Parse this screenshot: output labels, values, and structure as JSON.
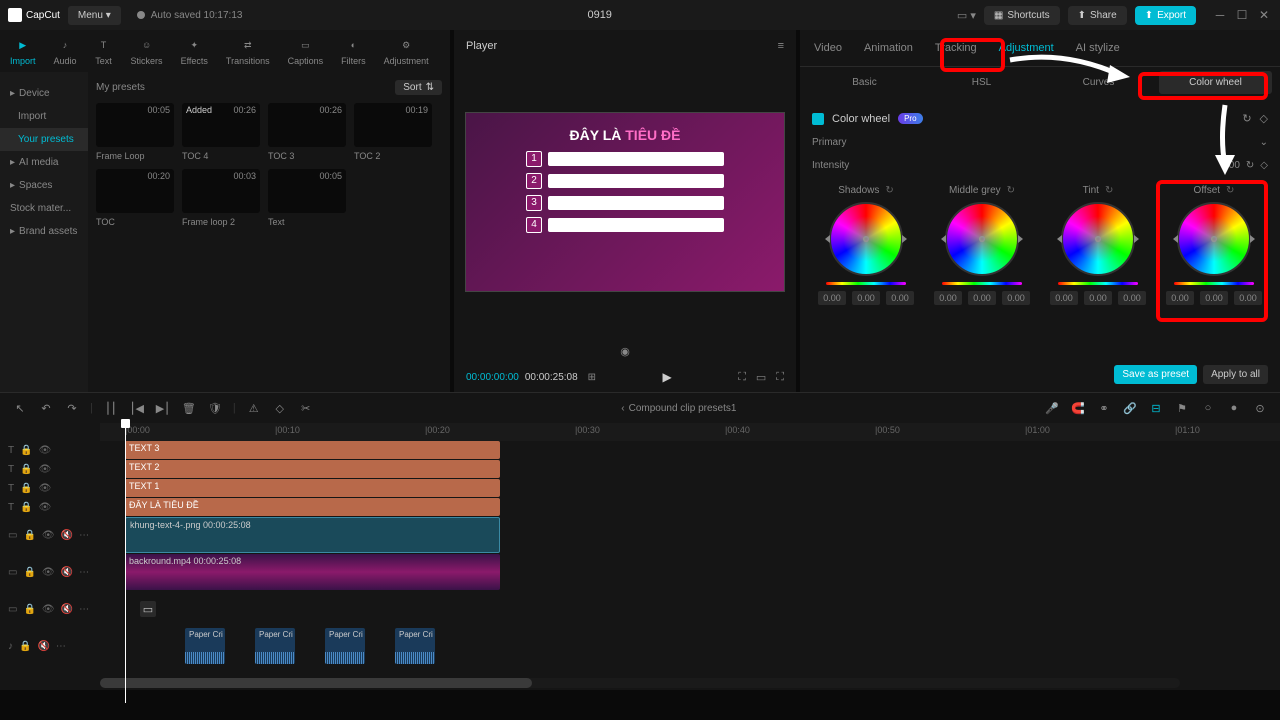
{
  "titlebar": {
    "app_name": "CapCut",
    "menu_label": "Menu ▾",
    "autosave": "Auto saved 10:17:13",
    "project_name": "0919",
    "shortcuts_label": "Shortcuts",
    "share_label": "Share",
    "export_label": "Export"
  },
  "media_tabs": [
    {
      "label": "Import",
      "active": true
    },
    {
      "label": "Audio"
    },
    {
      "label": "Text"
    },
    {
      "label": "Stickers"
    },
    {
      "label": "Effects"
    },
    {
      "label": "Transitions"
    },
    {
      "label": "Captions"
    },
    {
      "label": "Filters"
    },
    {
      "label": "Adjustment"
    }
  ],
  "sidebar_items": [
    {
      "label": "Device",
      "expandable": true,
      "active": false
    },
    {
      "label": "Import",
      "indent": true
    },
    {
      "label": "Your presets",
      "indent": true,
      "active": true
    },
    {
      "label": "AI media",
      "expandable": true
    },
    {
      "label": "Spaces",
      "expandable": true
    },
    {
      "label": "Stock mater..."
    },
    {
      "label": "Brand assets",
      "expandable": true
    }
  ],
  "media": {
    "header": "My presets",
    "sort_label": "Sort",
    "presets": [
      {
        "name": "Frame Loop",
        "time": "00:05"
      },
      {
        "name": "TOC 4",
        "time": "00:26",
        "added": "Added"
      },
      {
        "name": "TOC 3",
        "time": "00:26"
      },
      {
        "name": "TOC 2",
        "time": "00:19"
      },
      {
        "name": "TOC",
        "time": "00:20"
      },
      {
        "name": "Frame loop 2",
        "time": "00:03"
      },
      {
        "name": "Text",
        "time": "00:05"
      }
    ]
  },
  "player": {
    "title": "Player",
    "preview_heading_1": "ĐÂY LÀ",
    "preview_heading_2": "TIÊU ĐỀ",
    "current_time": "00:00:00:00",
    "duration": "00:00:25:08"
  },
  "inspector": {
    "tabs": [
      "Video",
      "Animation",
      "Tracking",
      "Adjustment",
      "AI stylize"
    ],
    "active_tab": "Adjustment",
    "subtabs": [
      "Basic",
      "HSL",
      "Curves",
      "Color wheel"
    ],
    "active_subtab": "Color wheel",
    "color_wheel_label": "Color wheel",
    "pro_label": "Pro",
    "primary_label": "Primary",
    "intensity_label": "Intensity",
    "intensity_value": "100",
    "wheels": [
      {
        "name": "Shadows",
        "values": [
          "0.00",
          "0.00",
          "0.00"
        ]
      },
      {
        "name": "Middle grey",
        "values": [
          "0.00",
          "0.00",
          "0.00"
        ]
      },
      {
        "name": "Tint",
        "values": [
          "0.00",
          "0.00",
          "0.00"
        ]
      },
      {
        "name": "Offset",
        "values": [
          "0.00",
          "0.00",
          "0.00"
        ]
      }
    ],
    "save_preset": "Save as preset",
    "apply_all": "Apply to all"
  },
  "timeline": {
    "compound_label": "Compound clip presets1",
    "ruler_marks": [
      "00:00",
      "00:10",
      "00:20",
      "00:30",
      "00:40",
      "00:50",
      "01:00",
      "01:10"
    ],
    "tracks": {
      "text3": "TEXT 3",
      "text2": "TEXT 2",
      "text1": "TEXT 1",
      "title": "ĐÂY LÀ TIÊU ĐỀ",
      "image": "khung-text-4-.png  00:00:25:08",
      "video": "backround.mp4  00:00:25:08",
      "audio_clips": [
        "Paper Cri",
        "Paper Cri",
        "Paper Cri",
        "Paper Cri"
      ]
    }
  }
}
